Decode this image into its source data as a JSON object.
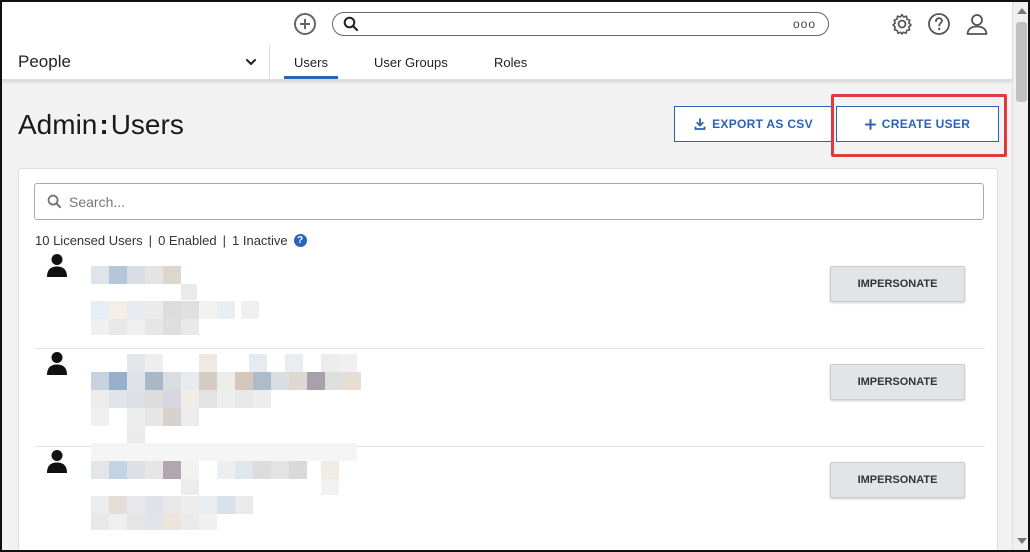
{
  "topbar": {
    "add_icon": "plus-circle-icon",
    "search_icon": "search-icon",
    "search_more": "ooo",
    "settings_icon": "gear-icon",
    "help_icon": "question-circle-icon",
    "profile_icon": "user-icon"
  },
  "nav": {
    "section_label": "People",
    "tabs": [
      {
        "label": "Users",
        "active": true
      },
      {
        "label": "User Groups",
        "active": false
      },
      {
        "label": "Roles",
        "active": false
      }
    ]
  },
  "header": {
    "title_prefix": "Admin",
    "title_separator": ":",
    "title_main": "Users",
    "export_label": "EXPORT AS CSV",
    "create_label": "CREATE USER"
  },
  "list": {
    "search_placeholder": "Search...",
    "summary_licensed": "10 Licensed Users",
    "summary_enabled": "0 Enabled",
    "summary_inactive": "1 Inactive",
    "summary_sep": "|",
    "help_glyph": "?",
    "impersonate_label": "IMPERSONATE"
  },
  "colors": {
    "accent": "#2a62b8",
    "highlight": "#e0393e"
  }
}
